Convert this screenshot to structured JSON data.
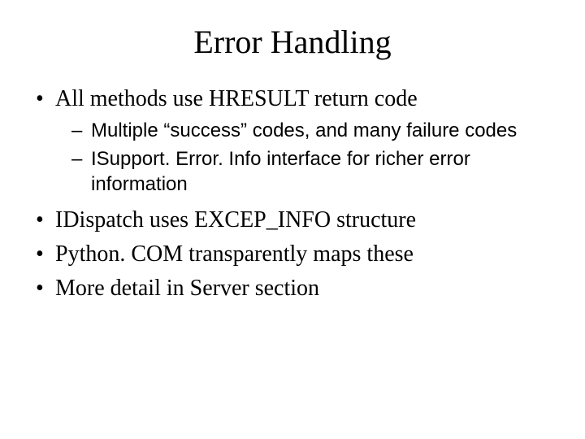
{
  "title": "Error Handling",
  "bullets": {
    "b1": "All methods use HRESULT return code",
    "b1_sub1": "Multiple “success” codes, and many failure codes",
    "b1_sub2": "ISupport. Error. Info interface for richer error information",
    "b2": "IDispatch uses EXCEP_INFO structure",
    "b3": "Python. COM transparently maps these",
    "b4": "More detail in Server section"
  }
}
